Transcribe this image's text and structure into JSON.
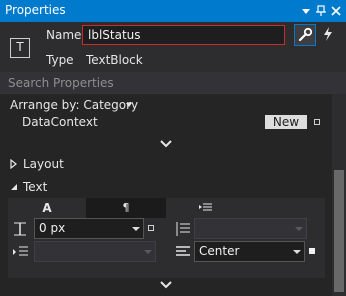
{
  "window": {
    "title": "Properties"
  },
  "header": {
    "type_icon_glyph": "T",
    "name_label": "Name",
    "name_value": "lblStatus",
    "type_label": "Type",
    "type_value": "TextBlock"
  },
  "search": {
    "placeholder": "Search Properties"
  },
  "arrange": {
    "label": "Arrange by: Category"
  },
  "datacontext": {
    "label": "DataContext",
    "new_button": "New"
  },
  "sections": {
    "layout": "Layout",
    "text": "Text"
  },
  "text_tabs": [
    "A",
    "¶",
    ""
  ],
  "text_props": {
    "font_size_value": "0 px",
    "alignment_value": "Center"
  },
  "colors": {
    "titlebar": "#007acc",
    "name_border": "#c92c2c",
    "panel_bg": "#252526"
  }
}
